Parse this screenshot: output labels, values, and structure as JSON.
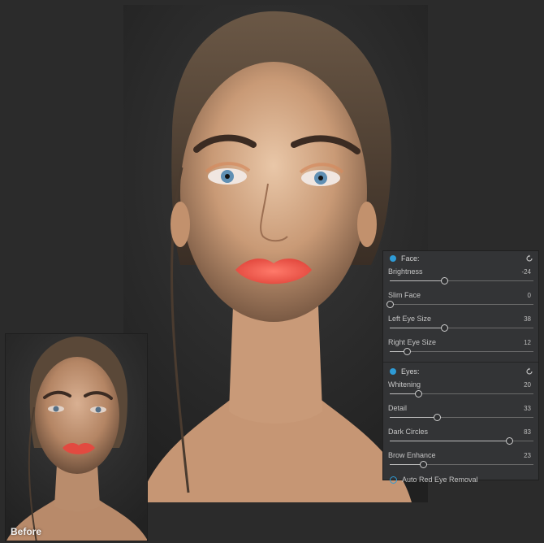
{
  "before_label": "Before",
  "colors": {
    "accent": "#2e9bd6",
    "panel_bg": "#333436",
    "page_bg": "#2b2b2b"
  },
  "face_section": {
    "title": "Face:",
    "sliders": [
      {
        "label": "Brightness",
        "value": "-24",
        "position": 0.38
      },
      {
        "label": "Slim Face",
        "value": "0",
        "position": 0.0
      },
      {
        "label": "Left Eye Size",
        "value": "38",
        "position": 0.38
      },
      {
        "label": "Right Eye Size",
        "value": "12",
        "position": 0.12
      }
    ]
  },
  "eyes_section": {
    "title": "Eyes:",
    "sliders": [
      {
        "label": "Whitening",
        "value": "20",
        "position": 0.2
      },
      {
        "label": "Detail",
        "value": "33",
        "position": 0.33
      },
      {
        "label": "Dark Circles",
        "value": "83",
        "position": 0.83
      },
      {
        "label": "Brow Enhance",
        "value": "23",
        "position": 0.23
      }
    ],
    "checkbox": {
      "label": "Auto Red Eye Removal",
      "checked": false
    }
  }
}
